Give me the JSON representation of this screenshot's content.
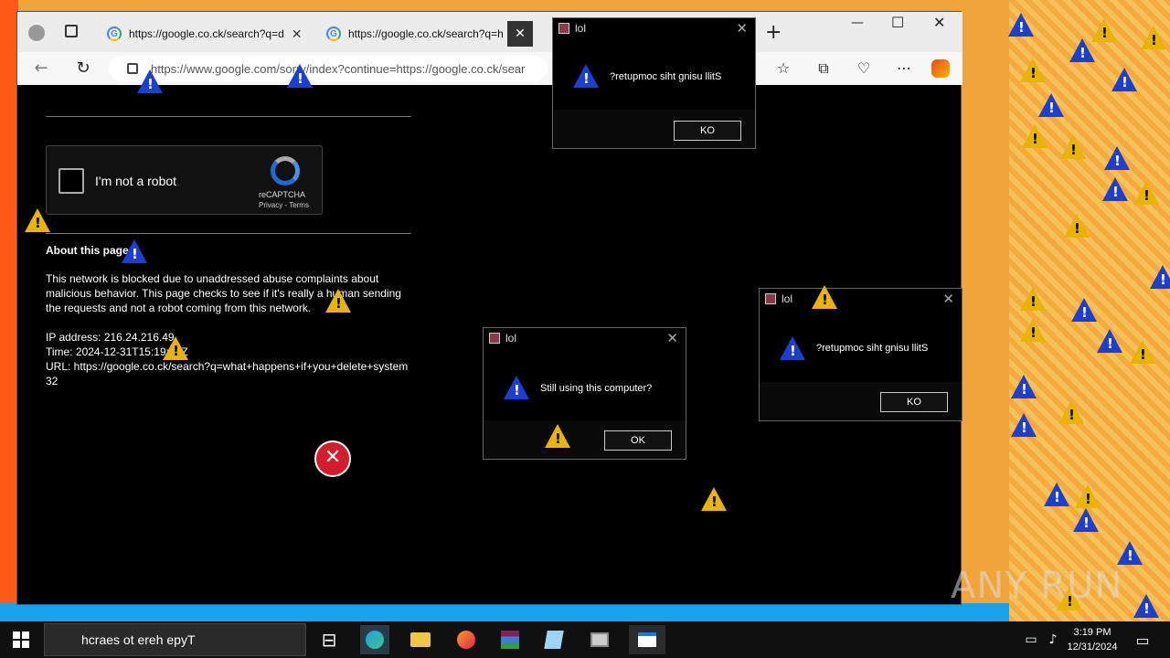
{
  "browser": {
    "tabs": [
      {
        "label": "https://google.co.ck/search?q=d"
      },
      {
        "label": "https://google.co.ck/search?q=h"
      }
    ],
    "new_tab": "+",
    "address": "https://www.google.com/sorry/index?continue=https://google.co.ck/sear",
    "window_controls": {
      "minimize": "—",
      "maximize": "☐",
      "close": "✕"
    }
  },
  "page": {
    "captcha_label": "I'm not a robot",
    "captcha_brand": "reCAPTCHA",
    "captcha_links": "Privacy - Terms",
    "about_heading": "About this page",
    "paragraph": "This network is blocked due to unaddressed abuse complaints about malicious behavior. This page checks to see if it's really a human sending the requests and not a robot coming from this network.",
    "ip": "IP address: 216.24.216.49",
    "time": "Time: 2024-12-31T15:19:22Z",
    "url": "URL: https://google.co.ck/search?q=what+happens+if+you+delete+system32"
  },
  "dialogs": [
    {
      "title": "lol",
      "message": "?retupmoc siht gnisu llitS",
      "button": "KO"
    },
    {
      "title": "lol",
      "message": "Still using this computer?",
      "button": "OK"
    },
    {
      "title": "lol",
      "message": "?retupmoc siht gnisu llitS",
      "button": "KO"
    }
  ],
  "taskbar": {
    "search_text": "hcraes ot ereh epyT",
    "time": "3:19 PM",
    "date": "12/31/2024"
  },
  "watermark": "ANY RUN",
  "colors": {
    "desktop_left": "#ff5a17",
    "desktop_right": "#f6a93c",
    "warning_yellow": "#e8b400",
    "warning_blue": "#1b3fd0"
  }
}
